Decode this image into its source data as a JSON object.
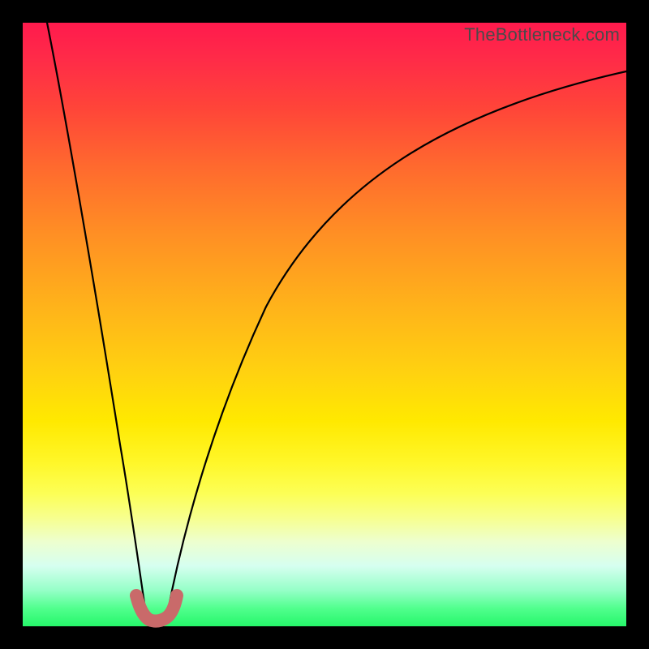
{
  "watermark": "TheBottleneck.com",
  "colors": {
    "frame_border": "#000000",
    "curve_stroke": "#000000",
    "marker_stroke": "#c96a6a",
    "gradient_top": "#ff1a4d",
    "gradient_bottom": "#26f76a"
  },
  "chart_data": {
    "type": "line",
    "title": "",
    "xlabel": "",
    "ylabel": "",
    "xlim": [
      0,
      100
    ],
    "ylim": [
      0,
      100
    ],
    "note": "Axes have no visible ticks or labels; values are estimated as percentage of plot width/height. y=0 at bottom, y=100 at top.",
    "series": [
      {
        "name": "left-branch",
        "x": [
          4.0,
          6.0,
          8.0,
          10.0,
          12.0,
          14.0,
          15.5,
          17.0,
          18.0,
          19.0,
          20.0
        ],
        "y": [
          100.0,
          88.0,
          75.0,
          62.0,
          48.0,
          34.0,
          23.0,
          14.0,
          8.0,
          3.5,
          1.0
        ]
      },
      {
        "name": "valley",
        "x": [
          20.0,
          21.0,
          22.0,
          23.0,
          24.0
        ],
        "y": [
          1.0,
          0.5,
          0.4,
          0.6,
          1.2
        ]
      },
      {
        "name": "right-branch",
        "x": [
          24.0,
          26.0,
          28.0,
          31.0,
          35.0,
          40.0,
          46.0,
          53.0,
          61.0,
          70.0,
          80.0,
          90.0,
          100.0
        ],
        "y": [
          1.2,
          5.0,
          10.0,
          18.0,
          28.0,
          39.0,
          50.0,
          60.0,
          69.0,
          77.0,
          83.5,
          88.5,
          92.5
        ]
      }
    ],
    "markers": [
      {
        "name": "valley-highlight",
        "description": "rounded U-shaped highlight at curve minimum",
        "x": [
          18.5,
          19.5,
          20.5,
          21.5,
          22.5,
          23.5,
          24.5,
          25.0
        ],
        "y": [
          4.5,
          2.0,
          0.8,
          0.6,
          0.6,
          1.0,
          2.2,
          4.0
        ]
      }
    ]
  }
}
